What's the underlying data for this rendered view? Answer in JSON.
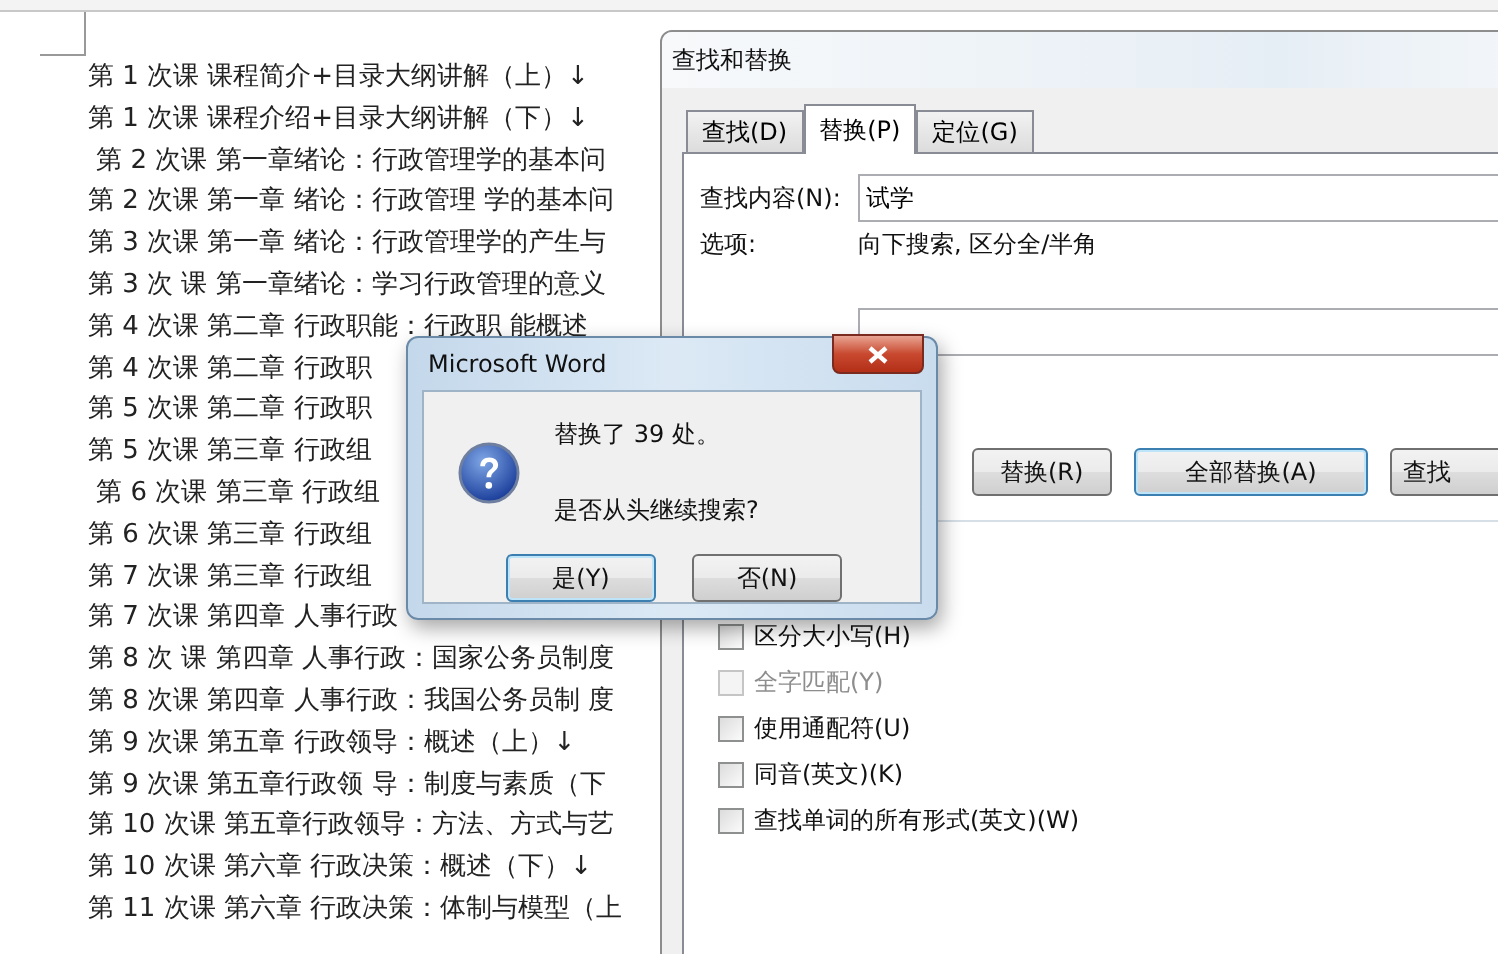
{
  "document": {
    "lines": [
      "第 1 次课 课程简介+目录大纲讲解（上）↓",
      "第 1 次课 课程介绍+目录大纲讲解（下）↓",
      " 第 2 次课 第一章绪论：行政管理学的基本问",
      "第 2 次课 第一章 绪论：行政管理 学的基本问",
      "第 3 次课 第一章 绪论：行政管理学的产生与",
      "第 3 次 课 第一章绪论：学习行政管理的意义",
      "第 4 次课 第二章 行政职能：行政职 能概述",
      "第 4 次课 第二章 行政职",
      "第 5 次课 第二章 行政职",
      "第 5 次课 第三章 行政组",
      " 第 6 次课 第三章 行政组",
      "第 6 次课 第三章 行政组",
      "第 7 次课 第三章 行政组",
      "第 7 次课 第四章 人事行政",
      "第 8 次 课 第四章 人事行政：国家公务员制度",
      "第 8 次课 第四章 人事行政：我国公务员制 度",
      "第 9 次课 第五章 行政领导：概述（上）↓",
      "第 9 次课 第五章行政领 导：制度与素质（下",
      "第 10 次课 第五章行政领导：方法、方式与艺",
      "第 10 次课 第六章 行政决策：概述（下）↓",
      "第 11 次课 第六章 行政决策：体制与模型（上"
    ]
  },
  "find_replace": {
    "title": "查找和替换",
    "tabs": [
      {
        "label": "查找(D)",
        "selected": false
      },
      {
        "label": "替换(P)",
        "selected": true
      },
      {
        "label": "定位(G)",
        "selected": false
      }
    ],
    "find_label": "查找内容(N):",
    "find_value": "试学",
    "options_label": "选项:",
    "options_value": "向下搜索, 区分全/半角",
    "buttons": [
      {
        "label": "替换(R)",
        "default": false
      },
      {
        "label": "全部替换(A)",
        "default": true
      },
      {
        "label": "查找",
        "default": false
      }
    ],
    "checkboxes": [
      {
        "label": "区分大小写(H)",
        "checked": false,
        "disabled": false
      },
      {
        "label": "全字匹配(Y)",
        "checked": false,
        "disabled": true
      },
      {
        "label": "使用通配符(U)",
        "checked": false,
        "disabled": false
      },
      {
        "label": "同音(英文)(K)",
        "checked": false,
        "disabled": false
      },
      {
        "label": "查找单词的所有形式(英文)(W)",
        "checked": false,
        "disabled": false
      }
    ]
  },
  "message_box": {
    "title": "Microsoft Word",
    "message": "替换了 39 处。",
    "question": "是否从头继续搜索?",
    "buttons": [
      {
        "label": "是(Y)",
        "default": true
      },
      {
        "label": "否(N)",
        "default": false
      }
    ]
  }
}
